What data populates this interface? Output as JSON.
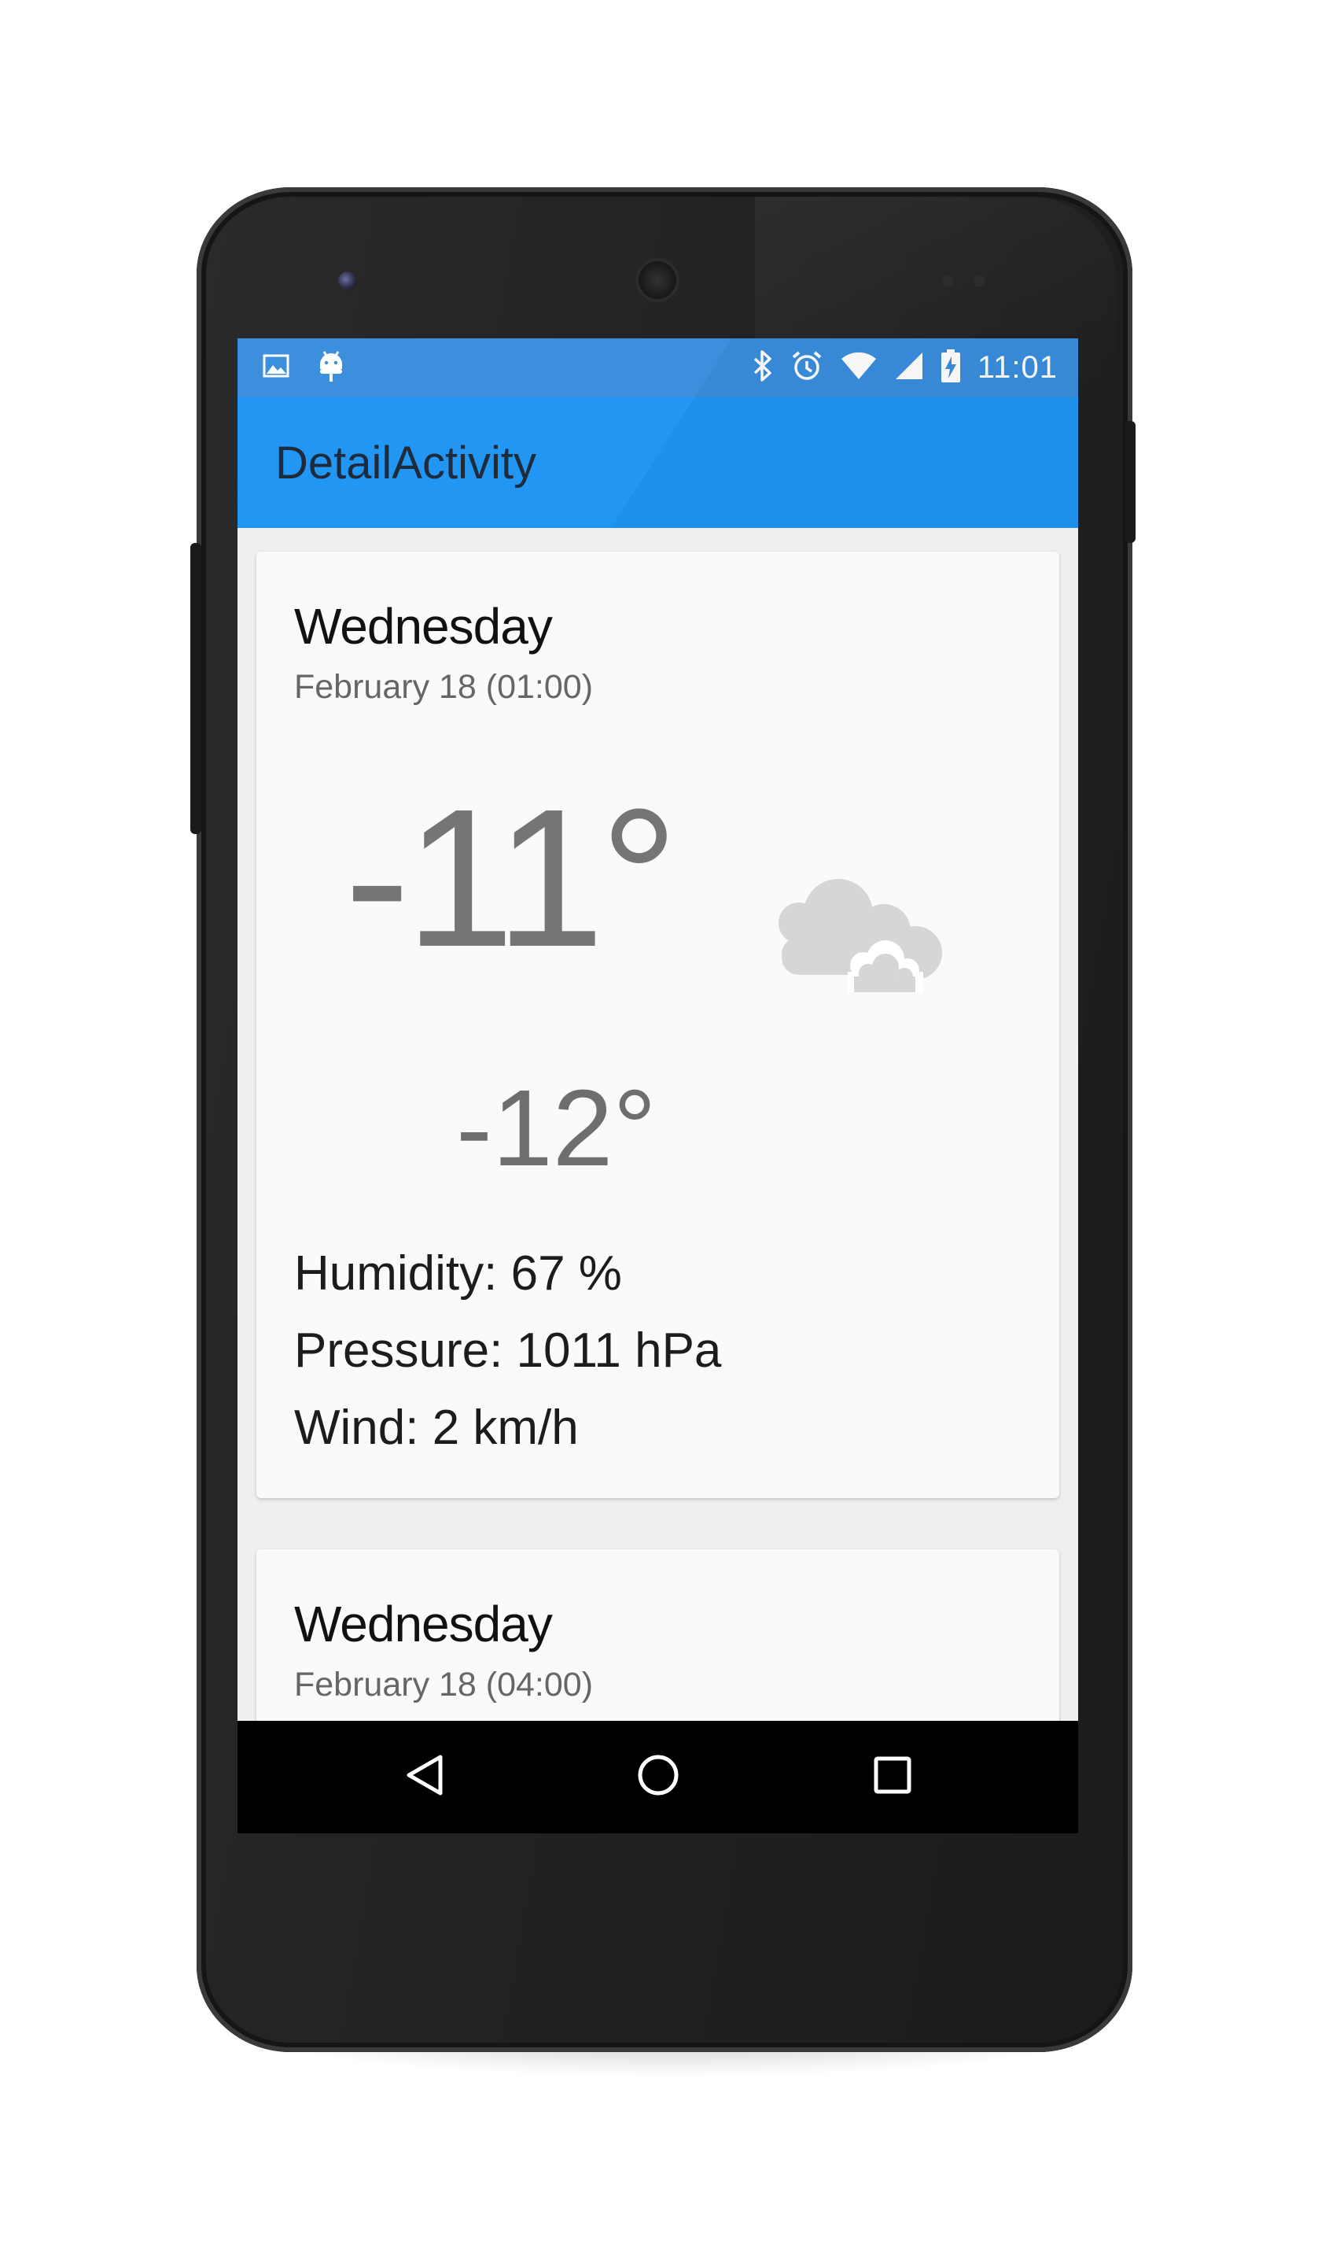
{
  "status_bar": {
    "time": "11:01",
    "left_icons": [
      "image-notification-icon",
      "android-notification-icon"
    ],
    "right_icons": [
      "bluetooth-icon",
      "alarm-icon",
      "wifi-icon",
      "signal-icon",
      "battery-charging-icon"
    ]
  },
  "app_bar": {
    "title": "DetailActivity"
  },
  "forecast": [
    {
      "day": "Wednesday",
      "date": "February 18 (01:00)",
      "high": "-11°",
      "low": "-12°",
      "icon": "cloudy-icon",
      "humidity": "Humidity: 67 %",
      "pressure": "Pressure: 1011 hPa",
      "wind": "Wind: 2 km/h"
    },
    {
      "day": "Wednesday",
      "date": "February 18 (04:00)"
    }
  ],
  "nav_bar": {
    "buttons": [
      "back-icon",
      "home-icon",
      "recents-icon"
    ]
  },
  "colors": {
    "status_bar": "#3b8fdd",
    "app_bar": "#2196f3",
    "background": "#efefef",
    "card": "#fafafa"
  }
}
